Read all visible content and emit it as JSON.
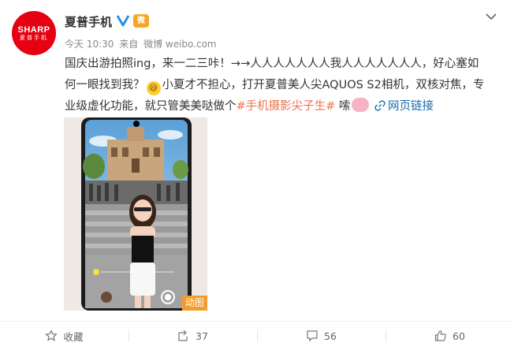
{
  "avatar": {
    "brand": "SHARP",
    "sub": "夏普手机"
  },
  "header": {
    "name": "夏普手机"
  },
  "meta": {
    "time": "今天 10:30",
    "from": "来自",
    "source": "微博 weibo.com"
  },
  "post": {
    "line1": "国庆出游拍照ing，来一二三咔！→→人人人人人人人我人人人人人人人，好心塞如",
    "line2_a": "何一眼找到我？",
    "line2_b": "小夏才不担心，打开夏普美人尖AQUOS S2相机，双核对焦，专",
    "line3_a": "业级虚化功能，就只管美美哒做个",
    "hashtag": "#手机摄影尖子生#",
    "line3_b": " 嗦",
    "web_link": "网页链接"
  },
  "media": {
    "badge": "动图"
  },
  "actions": {
    "favorite": "收藏",
    "repost": "37",
    "comment": "56",
    "like": "60"
  },
  "colors": {
    "accent": "#eb7350",
    "link": "#1a6aaa",
    "brand": "#e60012"
  }
}
